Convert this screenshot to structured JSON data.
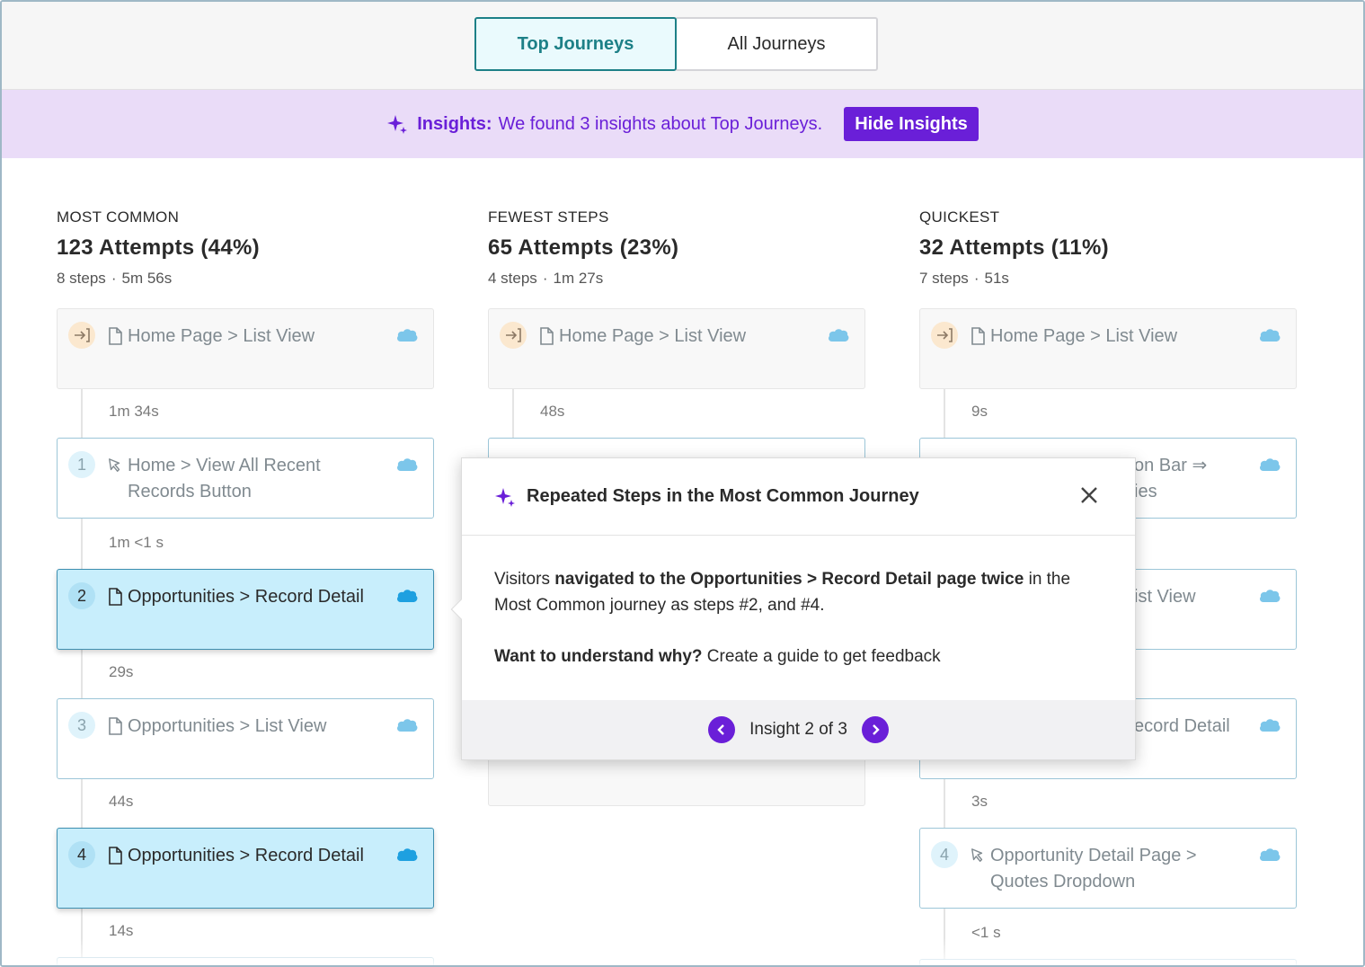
{
  "tabs": {
    "top": "Top Journeys",
    "all": "All Journeys"
  },
  "banner": {
    "label": "Insights:",
    "text": "We found 3 insights about Top Journeys.",
    "hide_button": "Hide Insights"
  },
  "columns": [
    {
      "kicker": "MOST COMMON",
      "title": "123 Attempts (44%)",
      "steps": "8 steps",
      "time": "5m 56s",
      "cards": [
        {
          "badge": "",
          "line1": "Home Page > List View",
          "line2": ""
        },
        {
          "badge": "1",
          "line1": "Home > View All Recent",
          "line2": "Records Button"
        },
        {
          "badge": "2",
          "line1": "Opportunities > Record Detail",
          "line2": ""
        },
        {
          "badge": "3",
          "line1": "Opportunities > List View",
          "line2": ""
        },
        {
          "badge": "4",
          "line1": "Opportunities > Record Detail",
          "line2": ""
        }
      ],
      "durations": [
        "1m 34s",
        "1m <1 s",
        "29s",
        "44s",
        "14s"
      ]
    },
    {
      "kicker": "FEWEST STEPS",
      "title": "65 Attempts (23%)",
      "steps": "4 steps",
      "time": "1m 27s",
      "cards": [
        {
          "badge": "",
          "line1": "Home Page > List View",
          "line2": ""
        }
      ],
      "durations": [
        "48s"
      ]
    },
    {
      "kicker": "QUICKEST",
      "title": "32 Attempts (11%)",
      "steps": "7 steps",
      "time": "51s",
      "cards": [
        {
          "badge": "",
          "line1": "Home Page > List View",
          "line2": ""
        },
        {
          "badge": "",
          "line1": "on Bar ⇒",
          "line2": "ies"
        },
        {
          "badge": "",
          "line1": "ist View",
          "line2": ""
        },
        {
          "badge": "",
          "line1": "ecord Detail",
          "line2": ""
        },
        {
          "badge": "4",
          "line1": "Opportunity Detail Page >",
          "line2": "Quotes Dropdown"
        }
      ],
      "durations": [
        "9s",
        "3s",
        "<1 s"
      ]
    }
  ],
  "popover": {
    "title": "Repeated Steps in the Most Common Journey",
    "body_pre": "Visitors ",
    "body_bold": "navigated to the Opportunities > Record Detail page twice",
    "body_post": " in the Most Common journey as steps #2, and #4.",
    "cta_bold": "Want to understand why?",
    "cta_text": " Create a guide to get feedback",
    "counter": "Insight 2 of 3"
  },
  "colors": {
    "accent_teal": "#1d8087",
    "insight_purple": "#6a1fd8",
    "banner_bg": "#eadcf8",
    "highlight_bg": "#c8eefc",
    "salesforce_blue": "#1ea0e0"
  }
}
